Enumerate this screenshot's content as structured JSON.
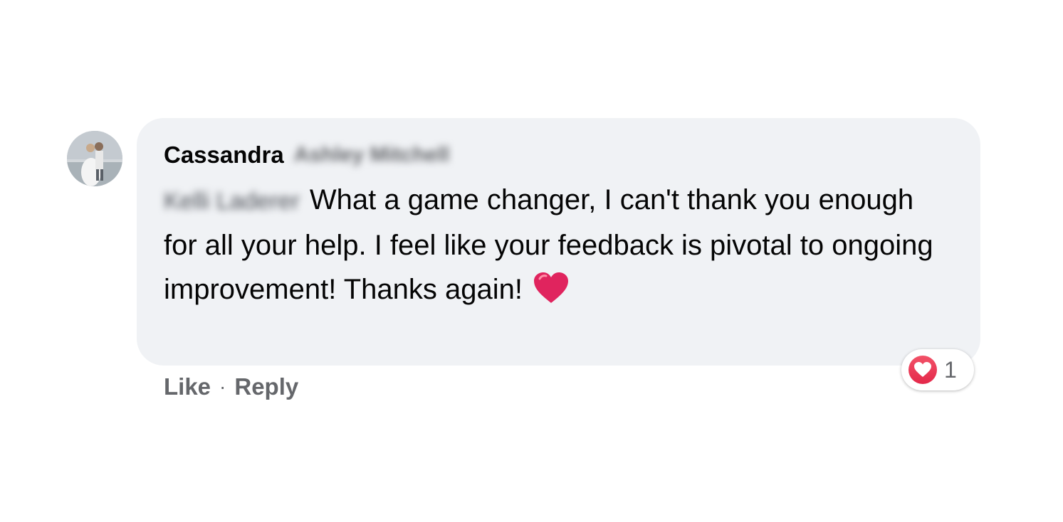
{
  "comment": {
    "author_first_name": "Cassandra",
    "author_rest_name": "Ashley Mitchell",
    "tagged_name": "Kelli Laderer",
    "text": "What a game changer, I can't thank you enough for all your help. I feel like your feedback is pivotal to ongoing improvement! Thanks again!",
    "emoji": "heart-emoji",
    "avatar": "avatar-photo"
  },
  "reactions": {
    "icon": "heart-reaction-icon",
    "count": "1",
    "color": "#e4284a"
  },
  "actions": {
    "like_label": "Like",
    "separator": "·",
    "reply_label": "Reply"
  },
  "colors": {
    "bubble": "#f0f2f5",
    "secondary_text": "#65676b",
    "heart": "#e0245e"
  }
}
